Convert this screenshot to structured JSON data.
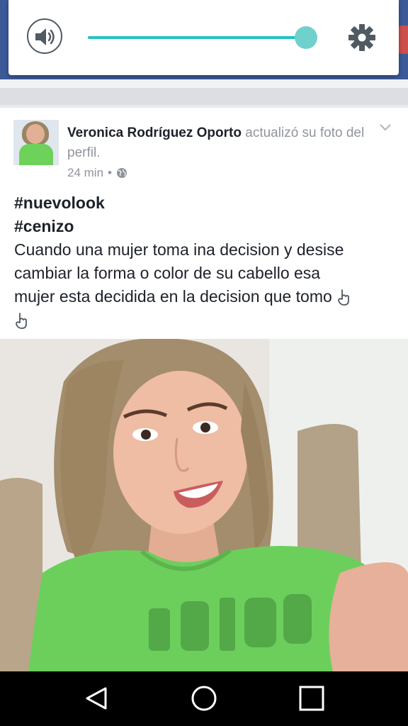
{
  "volume_panel": {
    "speaker_icon": "speaker-icon",
    "settings_icon": "gear-icon",
    "level": 0.95,
    "accent": "#21c2c6"
  },
  "post": {
    "author": "Veronica Rodríguez Oporto",
    "action": "actualizó su foto del perfil.",
    "time": "24 min",
    "separator": "•",
    "privacy_icon": "globe-icon",
    "menu_icon": "chevron-down-icon",
    "hashtags": [
      "#nuevolook",
      "#cenizo"
    ],
    "text_lines": [
      "Cuando una mujer toma ina decision y desise",
      "cambiar la forma o color de su cabello esa",
      "mujer esta decidida en la decision que tomo"
    ],
    "emoji_icon": "pointing-down-hand-icon"
  },
  "navbar": {
    "back_icon": "back-triangle-icon",
    "home_icon": "home-circle-icon",
    "recents_icon": "recents-square-icon"
  }
}
